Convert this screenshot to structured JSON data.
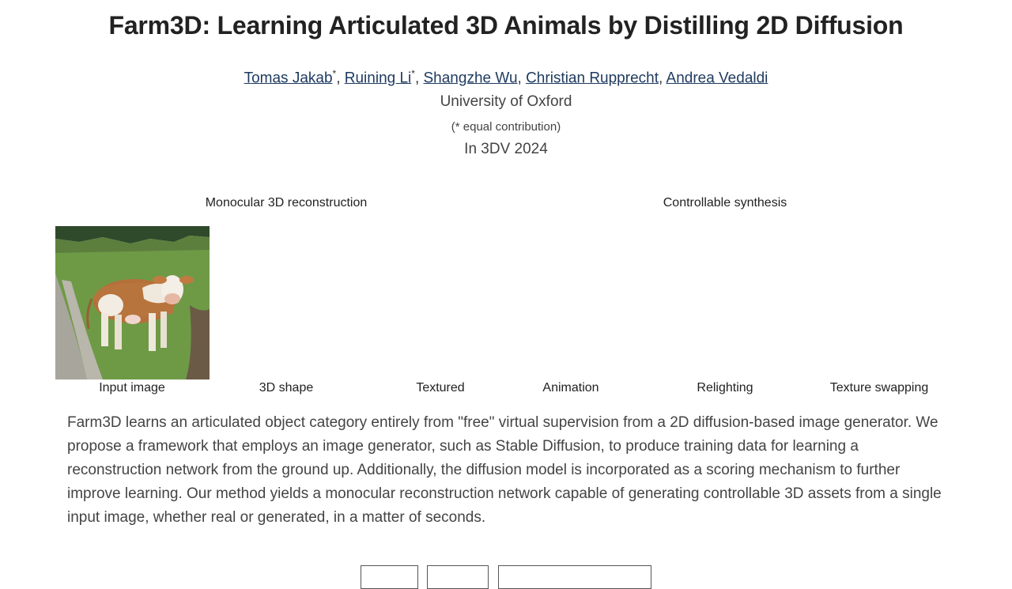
{
  "page": {
    "title": "Farm3D: Learning Articulated 3D Animals by Distilling 2D Diffusion",
    "authors": [
      {
        "name": "Tomas Jakab",
        "mark": "*"
      },
      {
        "name": "Ruining Li",
        "mark": "*"
      },
      {
        "name": "Shangzhe Wu",
        "mark": ""
      },
      {
        "name": "Christian Rupprecht",
        "mark": ""
      },
      {
        "name": "Andrea Vedaldi",
        "mark": ""
      }
    ],
    "author_separator": ", ",
    "affiliation": "University of Oxford",
    "contribution_note": "(* equal contribution)",
    "venue": "In 3DV 2024"
  },
  "figure": {
    "section_left": "Monocular 3D reconstruction",
    "section_right": "Controllable synthesis",
    "captions": [
      "Input image",
      "3D shape",
      "Textured",
      "Animation",
      "Relighting",
      "Texture swapping"
    ]
  },
  "abstract": "Farm3D learns an articulated object category entirely from \"free\" virtual supervision from a 2D diffusion-based image generator. We propose a framework that employs an image generator, such as Stable Diffusion, to produce training data for learning a reconstruction network from the ground up. Additionally, the diffusion model is incorporated as a scoring mechanism to further improve learning. Our method yields a monocular reconstruction network capable of generating controllable 3D assets from a single input image, whether real or generated, in a matter of seconds.",
  "colors": {
    "link": "#1e3a5f",
    "text": "#444444",
    "title": "#222222"
  }
}
